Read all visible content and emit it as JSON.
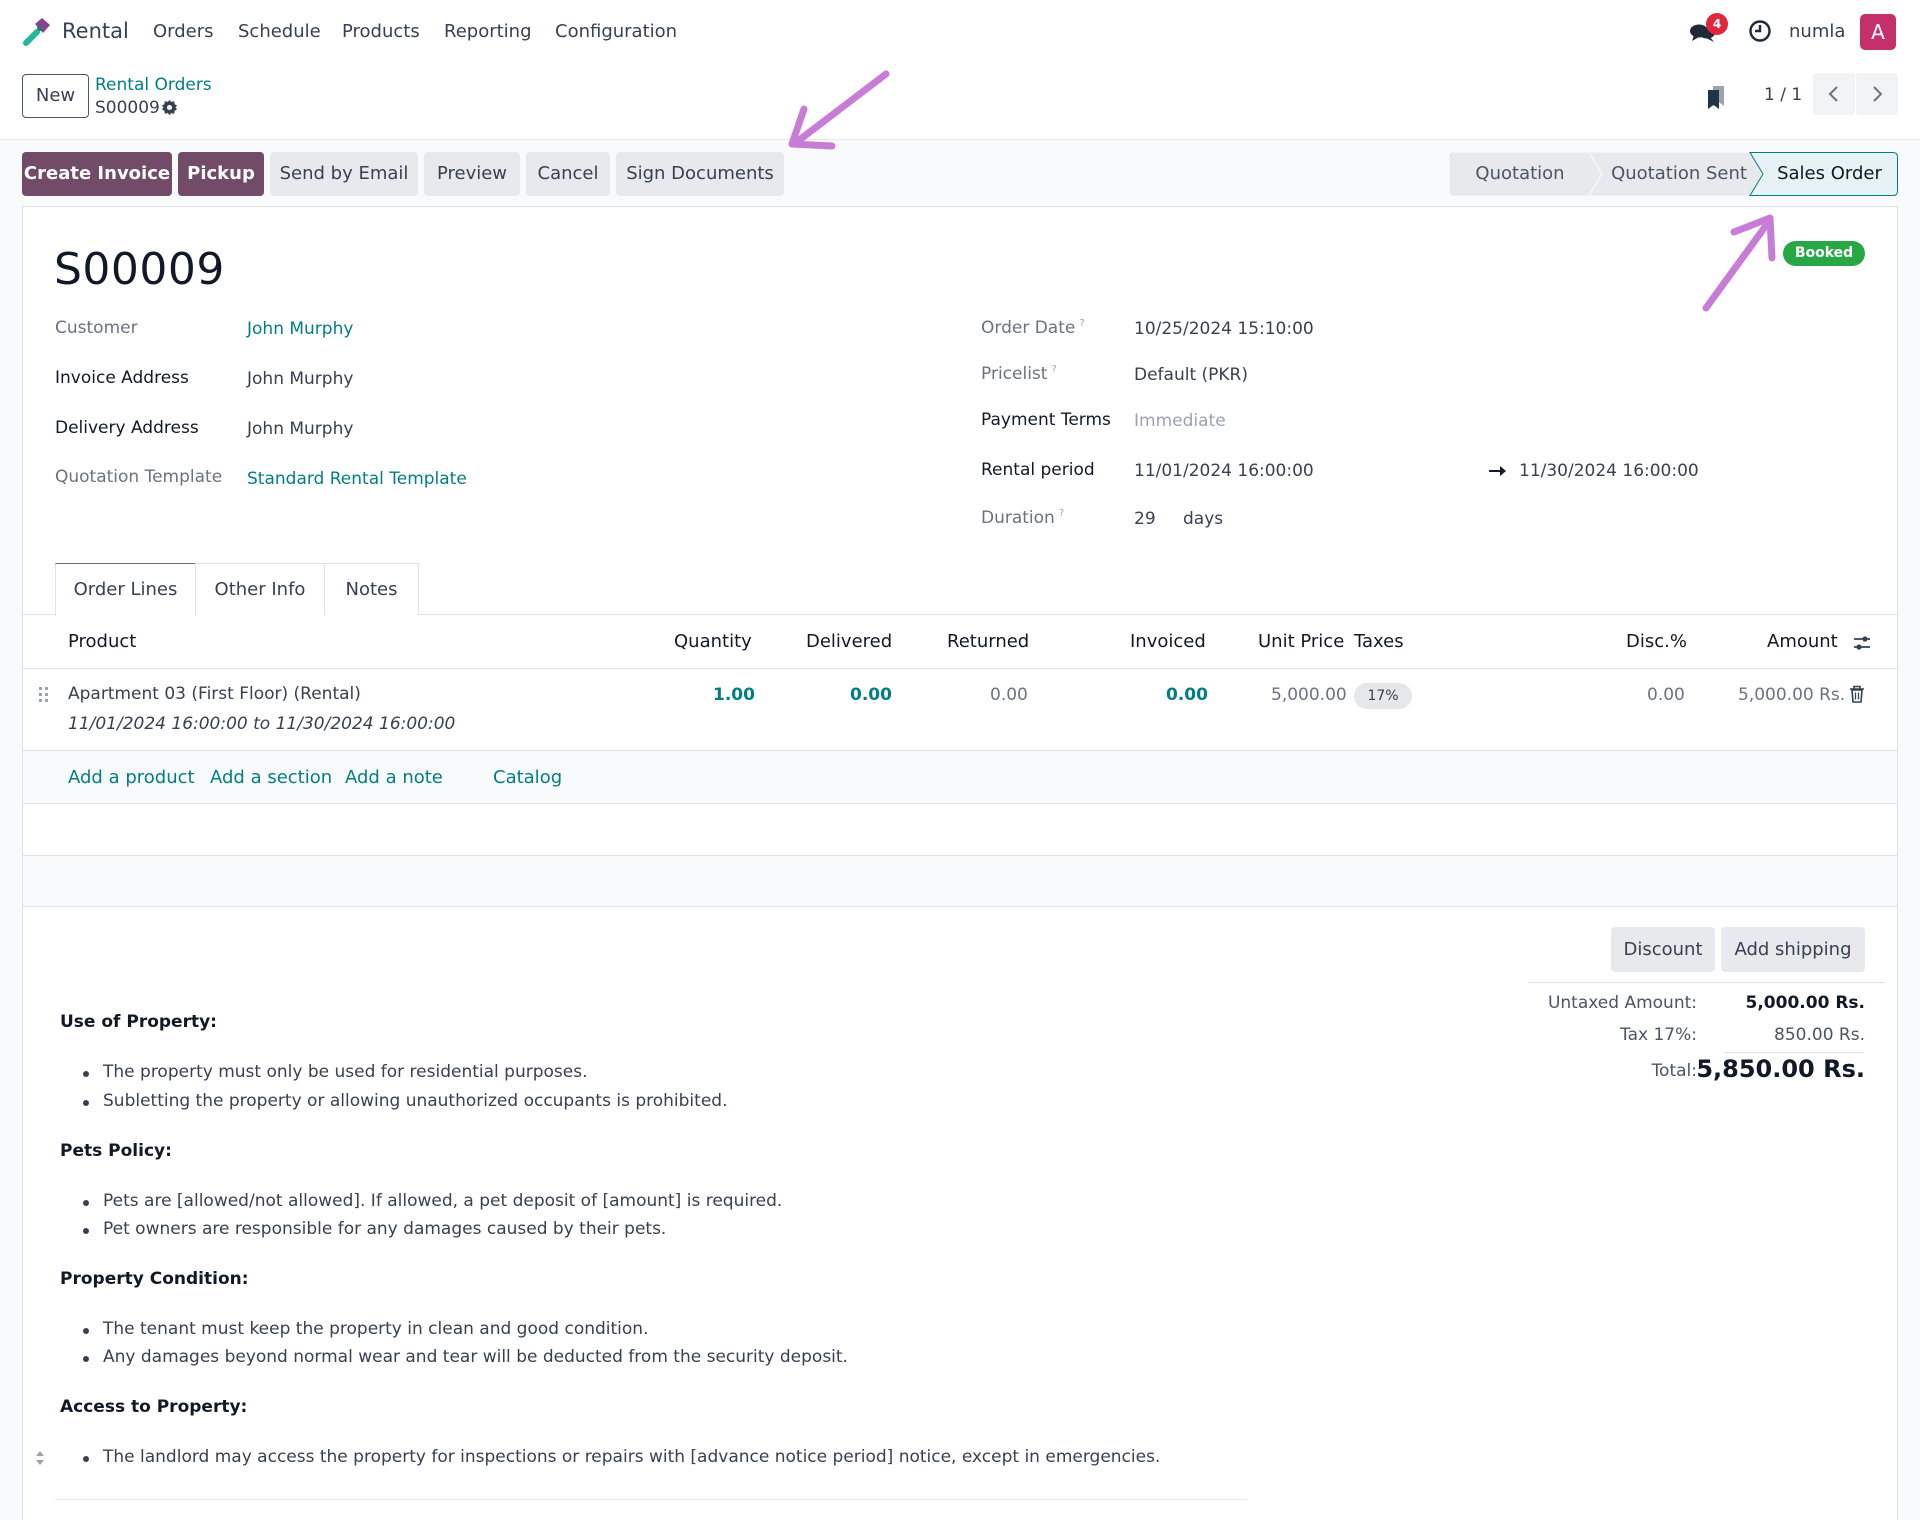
{
  "navbar": {
    "app_name": "Rental",
    "menu": [
      "Orders",
      "Schedule",
      "Products",
      "Reporting",
      "Configuration"
    ],
    "messages_count": "4",
    "username": "numla",
    "avatar_letter": "A"
  },
  "control_panel": {
    "new_label": "New",
    "breadcrumb_parent": "Rental Orders",
    "breadcrumb_current": "S00009",
    "pager": "1 / 1"
  },
  "actions": {
    "create_invoice": "Create Invoice",
    "pickup": "Pickup",
    "send_by_email": "Send by Email",
    "preview": "Preview",
    "cancel": "Cancel",
    "sign_documents": "Sign Documents"
  },
  "stages": {
    "items": [
      "Quotation",
      "Quotation Sent",
      "Sales Order"
    ],
    "active": "Sales Order"
  },
  "record": {
    "title": "S00009",
    "status_badge": "Booked",
    "left_fields": [
      {
        "label": "Customer",
        "value": "John Murphy"
      },
      {
        "label": "Invoice Address",
        "value": "John Murphy"
      },
      {
        "label": "Delivery Address",
        "value": "John Murphy"
      },
      {
        "label": "Quotation Template",
        "value": "Standard Rental Template"
      }
    ],
    "right_fields": {
      "order_date": {
        "label": "Order Date",
        "help": "?",
        "value": "10/25/2024 15:10:00"
      },
      "pricelist": {
        "label": "Pricelist",
        "help": "?",
        "value": "Default (PKR)"
      },
      "payment_terms": {
        "label": "Payment Terms",
        "value": "Immediate"
      },
      "rental_period": {
        "label": "Rental period",
        "start": "11/01/2024 16:00:00",
        "end": "11/30/2024 16:00:00"
      },
      "duration": {
        "label": "Duration",
        "help": "?",
        "value": "29",
        "unit": "days"
      }
    }
  },
  "tabs": [
    "Order Lines",
    "Other Info",
    "Notes"
  ],
  "order_lines": {
    "columns": [
      "Product",
      "Quantity",
      "Delivered",
      "Returned",
      "Invoiced",
      "Unit Price",
      "Taxes",
      "Disc.%",
      "Amount"
    ],
    "rows": [
      {
        "product": "Apartment 03 (First Floor) (Rental)",
        "period": "11/01/2024 16:00:00 to 11/30/2024 16:00:00",
        "quantity": "1.00",
        "delivered": "0.00",
        "returned": "0.00",
        "invoiced": "0.00",
        "unit_price": "5,000.00",
        "taxes": "17%",
        "discount": "0.00",
        "amount": "5,000.00 Rs."
      }
    ],
    "add_links": [
      "Add a product",
      "Add a section",
      "Add a note",
      "Catalog"
    ]
  },
  "totals": {
    "discount_button": "Discount",
    "shipping_button": "Add shipping",
    "untaxed_label": "Untaxed Amount:",
    "untaxed_value": "5,000.00 Rs.",
    "tax_label": "Tax 17%:",
    "tax_value": "850.00 Rs.",
    "total_label": "Total:",
    "total_value": "5,850.00 Rs."
  },
  "terms": [
    {
      "heading": "Use of Property:",
      "items": [
        "The property must only be used for residential purposes.",
        "Subletting the property or allowing unauthorized occupants is prohibited."
      ]
    },
    {
      "heading": "Pets Policy:",
      "items": [
        "Pets are [allowed/not allowed]. If allowed, a pet deposit of [amount] is required.",
        "Pet owners are responsible for any damages caused by their pets."
      ]
    },
    {
      "heading": "Property Condition:",
      "items": [
        "The tenant must keep the property in clean and good condition.",
        "Any damages beyond normal wear and tear will be deducted from the security deposit."
      ]
    },
    {
      "heading": "Access to Property:",
      "items": [
        "The landlord may access the property for inspections or repairs with [advance notice period] notice, except in emergencies."
      ]
    }
  ],
  "colors": {
    "primary": "#714b67",
    "link": "#017e84",
    "booked": "#28a745",
    "annotation": "#c77dd6"
  }
}
